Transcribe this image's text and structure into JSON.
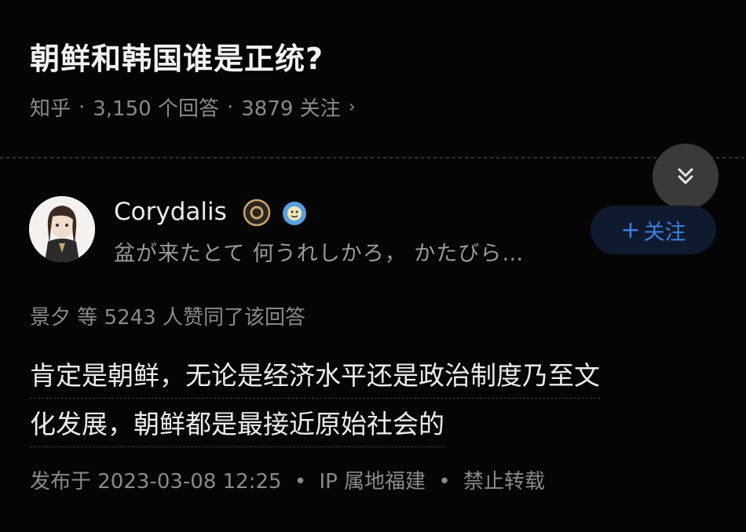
{
  "question": {
    "title": "朝鲜和韩国谁是正统?",
    "meta": {
      "source": "知乎",
      "answers": "3,150 个回答",
      "followers": "3879 关注",
      "separator": "·",
      "chevron": "›"
    }
  },
  "author": {
    "name": "Corydalis",
    "bio": "盆が来たとて 何うれしかろ， かたびら…",
    "follow_label": "关注",
    "follow_plus": "+"
  },
  "answer": {
    "upvote_info": "景夕 等 5243 人赞同了该回答",
    "lines": [
      "肯定是朝鲜，无论是经济水平还是政治制度乃至文",
      "化发展，朝鲜都是最接近原始社会的"
    ],
    "publish": {
      "date": "发布于 2023-03-08 12:25",
      "ip": "IP 属地福建",
      "rights": "禁止转载",
      "separator": "•"
    }
  },
  "colors": {
    "background": "#050505",
    "accent": "#3d7fe0",
    "badge_gold": "#c9a46a"
  },
  "icons": {
    "collapse": "double-chevron-down-icon",
    "badge": "crown-badge-icon",
    "badge2": "smiley-badge-icon"
  }
}
